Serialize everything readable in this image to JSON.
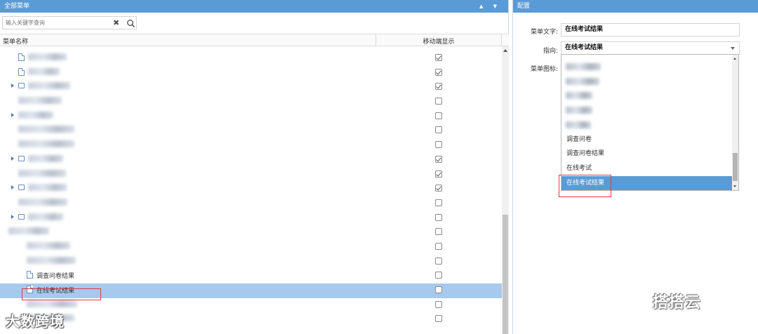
{
  "left_panel": {
    "title": "全部菜单",
    "search": {
      "placeholder": "输入关键字查询"
    },
    "columns": {
      "name": "菜单名称",
      "mobile": "移动端显示"
    },
    "rows": [
      {
        "label": "",
        "checked": true,
        "expandable": false,
        "icon": "doc",
        "indent": 1,
        "blurred": true
      },
      {
        "label": "",
        "checked": true,
        "expandable": false,
        "icon": "doc",
        "indent": 1,
        "blurred": true
      },
      {
        "label": "",
        "checked": true,
        "expandable": true,
        "icon": "folder",
        "indent": 1,
        "blurred": true
      },
      {
        "label": "",
        "checked": false,
        "expandable": false,
        "icon": "none",
        "indent": 1,
        "blurred": true
      },
      {
        "label": "",
        "checked": false,
        "expandable": true,
        "icon": "none",
        "indent": 1,
        "blurred": true
      },
      {
        "label": "",
        "checked": false,
        "expandable": false,
        "icon": "none",
        "indent": 1,
        "blurred": true
      },
      {
        "label": "",
        "checked": false,
        "expandable": false,
        "icon": "none",
        "indent": 1,
        "blurred": true
      },
      {
        "label": "",
        "checked": true,
        "expandable": true,
        "icon": "folder",
        "indent": 1,
        "blurred": true
      },
      {
        "label": "",
        "checked": true,
        "expandable": false,
        "icon": "none",
        "indent": 1,
        "blurred": true
      },
      {
        "label": "",
        "checked": true,
        "expandable": true,
        "icon": "folder",
        "indent": 1,
        "blurred": true
      },
      {
        "label": "",
        "checked": false,
        "expandable": false,
        "icon": "none",
        "indent": 1,
        "blurred": true
      },
      {
        "label": "",
        "checked": false,
        "expandable": true,
        "icon": "folder",
        "indent": 1,
        "blurred": true
      },
      {
        "label": "",
        "checked": false,
        "expandable": false,
        "icon": "none",
        "indent": 0,
        "blurred": true
      },
      {
        "label": "",
        "checked": false,
        "expandable": false,
        "icon": "none",
        "indent": 2,
        "blurred": true
      },
      {
        "label": "",
        "checked": false,
        "expandable": false,
        "icon": "none",
        "indent": 2,
        "blurred": true
      },
      {
        "label": "调查问卷结果",
        "checked": false,
        "expandable": false,
        "icon": "doc",
        "indent": 2,
        "blurred": false
      },
      {
        "label": "在线考试结果",
        "checked": false,
        "expandable": false,
        "icon": "doc",
        "indent": 2,
        "blurred": false,
        "selected": true
      },
      {
        "label": "",
        "checked": false,
        "expandable": false,
        "icon": "none",
        "indent": 2,
        "blurred": true
      },
      {
        "label": "",
        "checked": false,
        "expandable": false,
        "icon": "none",
        "indent": 2,
        "blurred": true
      }
    ]
  },
  "right_panel": {
    "title": "配置",
    "menu_text_label": "菜单文字:",
    "menu_text_value": "在线考试结果",
    "target_label": "指向:",
    "target_value": "在线考试结果",
    "icon_label": "菜单图标:",
    "dropdown_options": [
      {
        "label": "",
        "blurred": true
      },
      {
        "label": "",
        "blurred": true
      },
      {
        "label": "",
        "blurred": true
      },
      {
        "label": "",
        "blurred": true
      },
      {
        "label": "",
        "blurred": true
      },
      {
        "label": "调查问卷",
        "blurred": false
      },
      {
        "label": "调查问卷结果",
        "blurred": false
      },
      {
        "label": "在线考试",
        "blurred": false
      },
      {
        "label": "在线考试结果",
        "blurred": false,
        "selected": true
      }
    ]
  },
  "watermarks": {
    "left": "大数跨境",
    "right": "搭搭云"
  },
  "colors": {
    "header": "#5b9bd5",
    "row_selected": "#a7c9ed",
    "highlight_box": "#e0393e"
  }
}
